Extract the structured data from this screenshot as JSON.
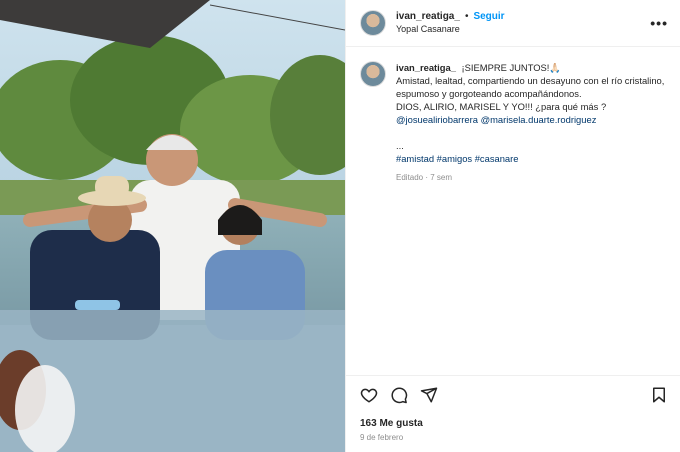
{
  "post": {
    "username": "ivan_reatiga_",
    "follow_label": "Seguir",
    "separator": "•",
    "location": "Yopal Casanare",
    "more_label": "•••",
    "caption": {
      "username": "ivan_reatiga_",
      "line1": "¡SIEMPRE JUNTOS!🙏🏻",
      "line2": "Amistad, lealtad, compartiendo un desayuno con el río cristalino,",
      "line3": "espumoso y gorgoteando acompañándonos.",
      "line4": "DIOS, ALIRIO, MARISEL Y YO!!! ¿para qué más ?",
      "mention1": "@josuealiriobarrera",
      "mention2": "@marisela.duarte.rodriguez",
      "ellipsis": "...",
      "tag1": "#amistad",
      "tag2": "#amigos",
      "tag3": "#casanare",
      "edited": "Editado · 7 sem"
    },
    "actions": {
      "like_icon": "heart-icon",
      "comment_icon": "comment-icon",
      "share_icon": "share-icon",
      "save_icon": "bookmark-icon"
    },
    "likes": "163 Me gusta",
    "date": "9 de febrero"
  }
}
